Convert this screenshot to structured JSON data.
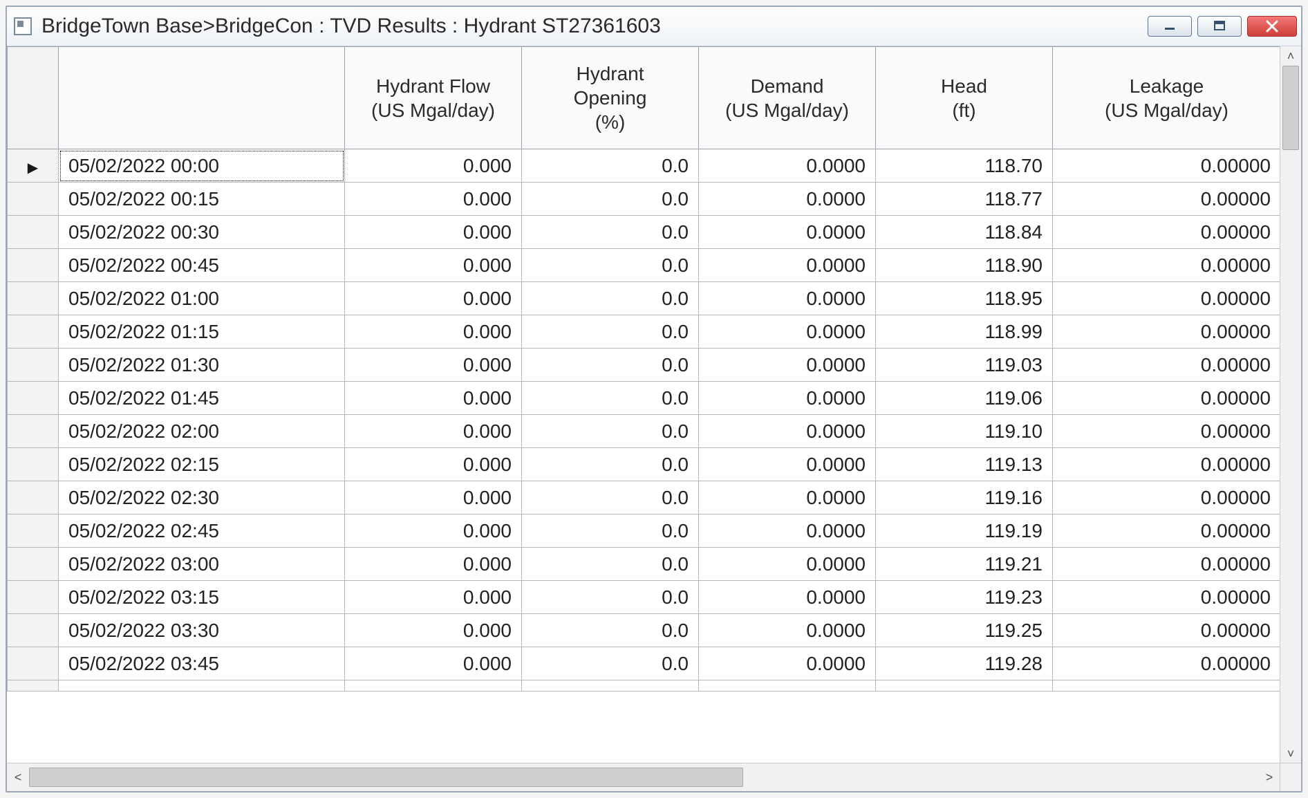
{
  "window": {
    "title": "BridgeTown Base>BridgeCon : TVD Results : Hydrant  ST27361603"
  },
  "table": {
    "headers": {
      "rowhdr": "",
      "time": "",
      "flow": "Hydrant Flow\n(US Mgal/day)",
      "opening": "Hydrant\nOpening\n(%)",
      "demand": "Demand\n(US Mgal/day)",
      "head": "Head\n(ft)",
      "leakage": "Leakage\n(US Mgal/day)"
    },
    "rows": [
      {
        "time": "05/02/2022 00:00",
        "flow": "0.000",
        "opening": "0.0",
        "demand": "0.0000",
        "head": "118.70",
        "leakage": "0.00000"
      },
      {
        "time": "05/02/2022 00:15",
        "flow": "0.000",
        "opening": "0.0",
        "demand": "0.0000",
        "head": "118.77",
        "leakage": "0.00000"
      },
      {
        "time": "05/02/2022 00:30",
        "flow": "0.000",
        "opening": "0.0",
        "demand": "0.0000",
        "head": "118.84",
        "leakage": "0.00000"
      },
      {
        "time": "05/02/2022 00:45",
        "flow": "0.000",
        "opening": "0.0",
        "demand": "0.0000",
        "head": "118.90",
        "leakage": "0.00000"
      },
      {
        "time": "05/02/2022 01:00",
        "flow": "0.000",
        "opening": "0.0",
        "demand": "0.0000",
        "head": "118.95",
        "leakage": "0.00000"
      },
      {
        "time": "05/02/2022 01:15",
        "flow": "0.000",
        "opening": "0.0",
        "demand": "0.0000",
        "head": "118.99",
        "leakage": "0.00000"
      },
      {
        "time": "05/02/2022 01:30",
        "flow": "0.000",
        "opening": "0.0",
        "demand": "0.0000",
        "head": "119.03",
        "leakage": "0.00000"
      },
      {
        "time": "05/02/2022 01:45",
        "flow": "0.000",
        "opening": "0.0",
        "demand": "0.0000",
        "head": "119.06",
        "leakage": "0.00000"
      },
      {
        "time": "05/02/2022 02:00",
        "flow": "0.000",
        "opening": "0.0",
        "demand": "0.0000",
        "head": "119.10",
        "leakage": "0.00000"
      },
      {
        "time": "05/02/2022 02:15",
        "flow": "0.000",
        "opening": "0.0",
        "demand": "0.0000",
        "head": "119.13",
        "leakage": "0.00000"
      },
      {
        "time": "05/02/2022 02:30",
        "flow": "0.000",
        "opening": "0.0",
        "demand": "0.0000",
        "head": "119.16",
        "leakage": "0.00000"
      },
      {
        "time": "05/02/2022 02:45",
        "flow": "0.000",
        "opening": "0.0",
        "demand": "0.0000",
        "head": "119.19",
        "leakage": "0.00000"
      },
      {
        "time": "05/02/2022 03:00",
        "flow": "0.000",
        "opening": "0.0",
        "demand": "0.0000",
        "head": "119.21",
        "leakage": "0.00000"
      },
      {
        "time": "05/02/2022 03:15",
        "flow": "0.000",
        "opening": "0.0",
        "demand": "0.0000",
        "head": "119.23",
        "leakage": "0.00000"
      },
      {
        "time": "05/02/2022 03:30",
        "flow": "0.000",
        "opening": "0.0",
        "demand": "0.0000",
        "head": "119.25",
        "leakage": "0.00000"
      },
      {
        "time": "05/02/2022 03:45",
        "flow": "0.000",
        "opening": "0.0",
        "demand": "0.0000",
        "head": "119.28",
        "leakage": "0.00000"
      }
    ],
    "active_row_index": 0
  }
}
